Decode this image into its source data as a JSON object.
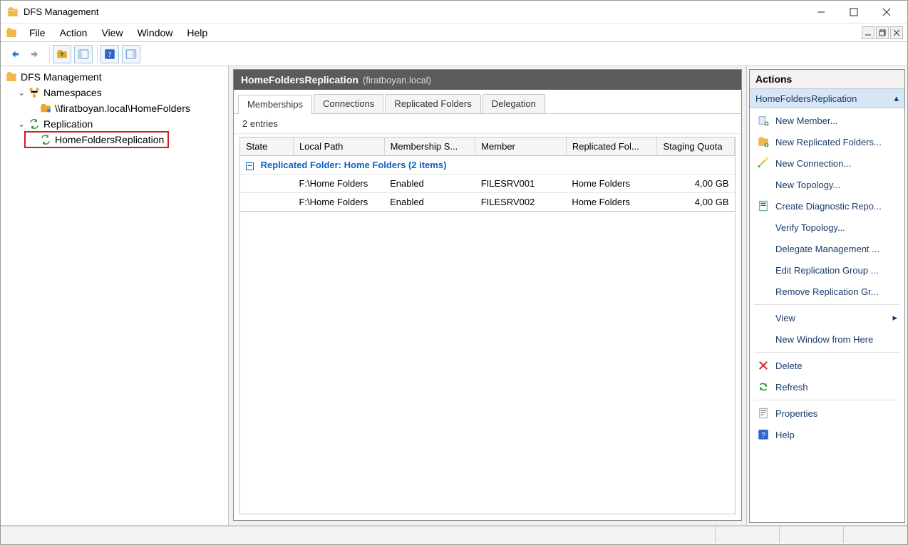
{
  "window": {
    "title": "DFS Management"
  },
  "menu": {
    "items": [
      "File",
      "Action",
      "View",
      "Window",
      "Help"
    ]
  },
  "tree": {
    "root": "DFS Management",
    "namespaces": {
      "label": "Namespaces",
      "items": [
        "\\\\firatboyan.local\\HomeFolders"
      ]
    },
    "replication": {
      "label": "Replication",
      "items": [
        "HomeFoldersReplication"
      ]
    }
  },
  "center": {
    "title": "HomeFoldersReplication",
    "context": "(firatboyan.local)",
    "tabs": [
      "Memberships",
      "Connections",
      "Replicated Folders",
      "Delegation"
    ],
    "active_tab": 0,
    "entries_label": "2 entries",
    "columns": [
      "State",
      "Local Path",
      "Membership S...",
      "Member",
      "Replicated Fol...",
      "Staging Quota"
    ],
    "group_label": "Replicated Folder: Home Folders (2 items)",
    "rows": [
      {
        "state": "",
        "local_path": "F:\\Home Folders",
        "membership_status": "Enabled",
        "member": "FILESRV001",
        "replicated_folder": "Home Folders",
        "staging_quota": "4,00 GB"
      },
      {
        "state": "",
        "local_path": "F:\\Home Folders",
        "membership_status": "Enabled",
        "member": "FILESRV002",
        "replicated_folder": "Home Folders",
        "staging_quota": "4,00 GB"
      }
    ]
  },
  "actions": {
    "title": "Actions",
    "context": "HomeFoldersReplication",
    "items": [
      "New Member...",
      "New Replicated Folders...",
      "New Connection...",
      "New Topology...",
      "Create Diagnostic Repo...",
      "Verify Topology...",
      "Delegate Management ...",
      "Edit Replication Group ...",
      "Remove Replication Gr..."
    ],
    "secondary": [
      "View",
      "New Window from Here"
    ],
    "tertiary": [
      "Delete",
      "Refresh",
      "Properties",
      "Help"
    ]
  }
}
